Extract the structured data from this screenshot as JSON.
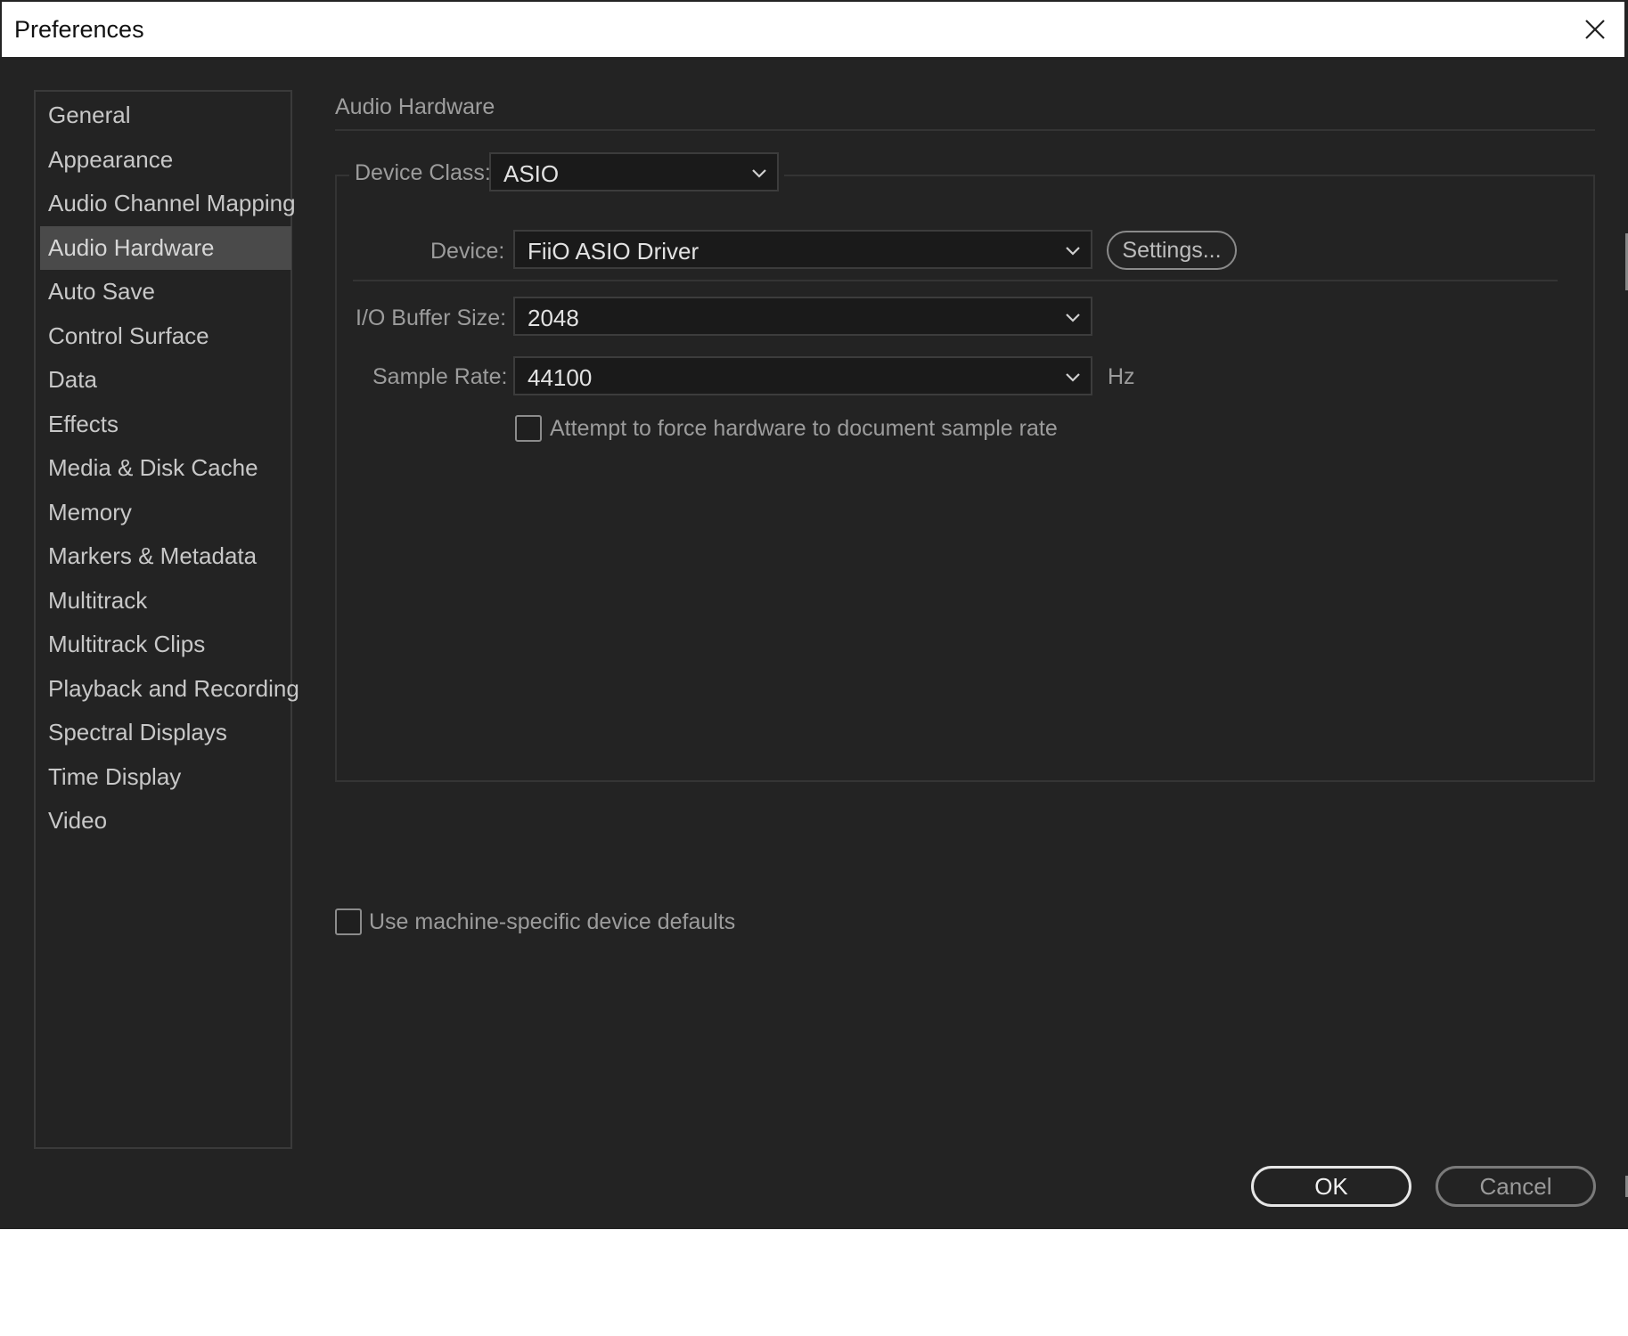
{
  "window": {
    "title": "Preferences",
    "close_icon": "close-icon"
  },
  "sidebar": {
    "items": [
      {
        "label": "General",
        "selected": false
      },
      {
        "label": "Appearance",
        "selected": false
      },
      {
        "label": "Audio Channel Mapping",
        "selected": false
      },
      {
        "label": "Audio Hardware",
        "selected": true
      },
      {
        "label": "Auto Save",
        "selected": false
      },
      {
        "label": "Control Surface",
        "selected": false
      },
      {
        "label": "Data",
        "selected": false
      },
      {
        "label": "Effects",
        "selected": false
      },
      {
        "label": "Media & Disk Cache",
        "selected": false
      },
      {
        "label": "Memory",
        "selected": false
      },
      {
        "label": "Markers & Metadata",
        "selected": false
      },
      {
        "label": "Multitrack",
        "selected": false
      },
      {
        "label": "Multitrack Clips",
        "selected": false
      },
      {
        "label": "Playback and Recording",
        "selected": false
      },
      {
        "label": "Spectral Displays",
        "selected": false
      },
      {
        "label": "Time Display",
        "selected": false
      },
      {
        "label": "Video",
        "selected": false
      }
    ]
  },
  "main": {
    "section_title": "Audio Hardware",
    "device_class": {
      "label": "Device Class:",
      "value": "ASIO"
    },
    "device": {
      "label": "Device:",
      "value": "FiiO ASIO Driver",
      "settings_label": "Settings..."
    },
    "buffer_size": {
      "label": "I/O Buffer Size:",
      "value": "2048"
    },
    "sample_rate": {
      "label": "Sample Rate:",
      "value": "44100",
      "unit": "Hz"
    },
    "force_rate": {
      "label": "Attempt to force hardware to document sample rate",
      "checked": false
    },
    "machine_defaults": {
      "label": "Use machine-specific device defaults",
      "checked": false
    }
  },
  "footer": {
    "ok_label": "OK",
    "cancel_label": "Cancel"
  },
  "colors": {
    "background": "#232323",
    "selected_item": "#4a4a4a",
    "dropdown_bg": "#1a1a1a"
  }
}
